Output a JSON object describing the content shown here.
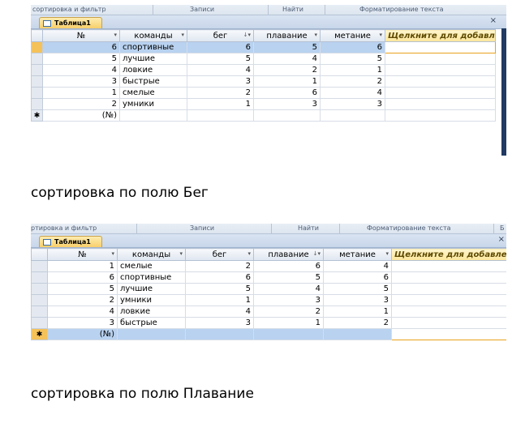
{
  "screen1": {
    "ribbon": {
      "groups": [
        "сортировка и фильтр",
        "Записи",
        "Найти",
        "Форматирование текста"
      ]
    },
    "tab_title": "Таблица1",
    "close": "×",
    "columns": {
      "num": "№",
      "team": "команды",
      "run": "бег",
      "swim": "плавание",
      "throw": "метание",
      "add": "Щелкните для добавления"
    },
    "rows": [
      {
        "num": "6",
        "team": "спортивные",
        "run": "6",
        "swim": "5",
        "throw": "6"
      },
      {
        "num": "5",
        "team": "лучшие",
        "run": "5",
        "swim": "4",
        "throw": "5"
      },
      {
        "num": "4",
        "team": "ловкие",
        "run": "4",
        "swim": "2",
        "throw": "1"
      },
      {
        "num": "3",
        "team": "быстрые",
        "run": "3",
        "swim": "1",
        "throw": "2"
      },
      {
        "num": "1",
        "team": "смелые",
        "run": "2",
        "swim": "6",
        "throw": "4"
      },
      {
        "num": "2",
        "team": "умники",
        "run": "1",
        "swim": "3",
        "throw": "3"
      }
    ],
    "new_row": {
      "marker": "✱",
      "num": "(№)"
    }
  },
  "caption1": "сортировка по полю Бег",
  "screen2": {
    "ribbon": {
      "groups": [
        "ртировка и фильтр",
        "Записи",
        "Найти",
        "Форматирование текста",
        "Б"
      ]
    },
    "tab_title": "Таблица1",
    "close": "×",
    "columns": {
      "num": "№",
      "team": "команды",
      "run": "бег",
      "swim": "плавание",
      "throw": "метание",
      "add": "Щелкните для добавления"
    },
    "rows": [
      {
        "num": "1",
        "team": "смелые",
        "run": "2",
        "swim": "6",
        "throw": "4"
      },
      {
        "num": "6",
        "team": "спортивные",
        "run": "6",
        "swim": "5",
        "throw": "6"
      },
      {
        "num": "5",
        "team": "лучшие",
        "run": "5",
        "swim": "4",
        "throw": "5"
      },
      {
        "num": "2",
        "team": "умники",
        "run": "1",
        "swim": "3",
        "throw": "3"
      },
      {
        "num": "4",
        "team": "ловкие",
        "run": "4",
        "swim": "2",
        "throw": "1"
      },
      {
        "num": "3",
        "team": "быстрые",
        "run": "3",
        "swim": "1",
        "throw": "2"
      }
    ],
    "new_row": {
      "marker": "✱",
      "num": "(№)"
    }
  },
  "caption2": "сортировка по полю Плавание",
  "colors": {
    "selected_row": "#b8d2f0",
    "record_selector_active": "#f5c25a",
    "tab_active": "#f8cf6a"
  }
}
